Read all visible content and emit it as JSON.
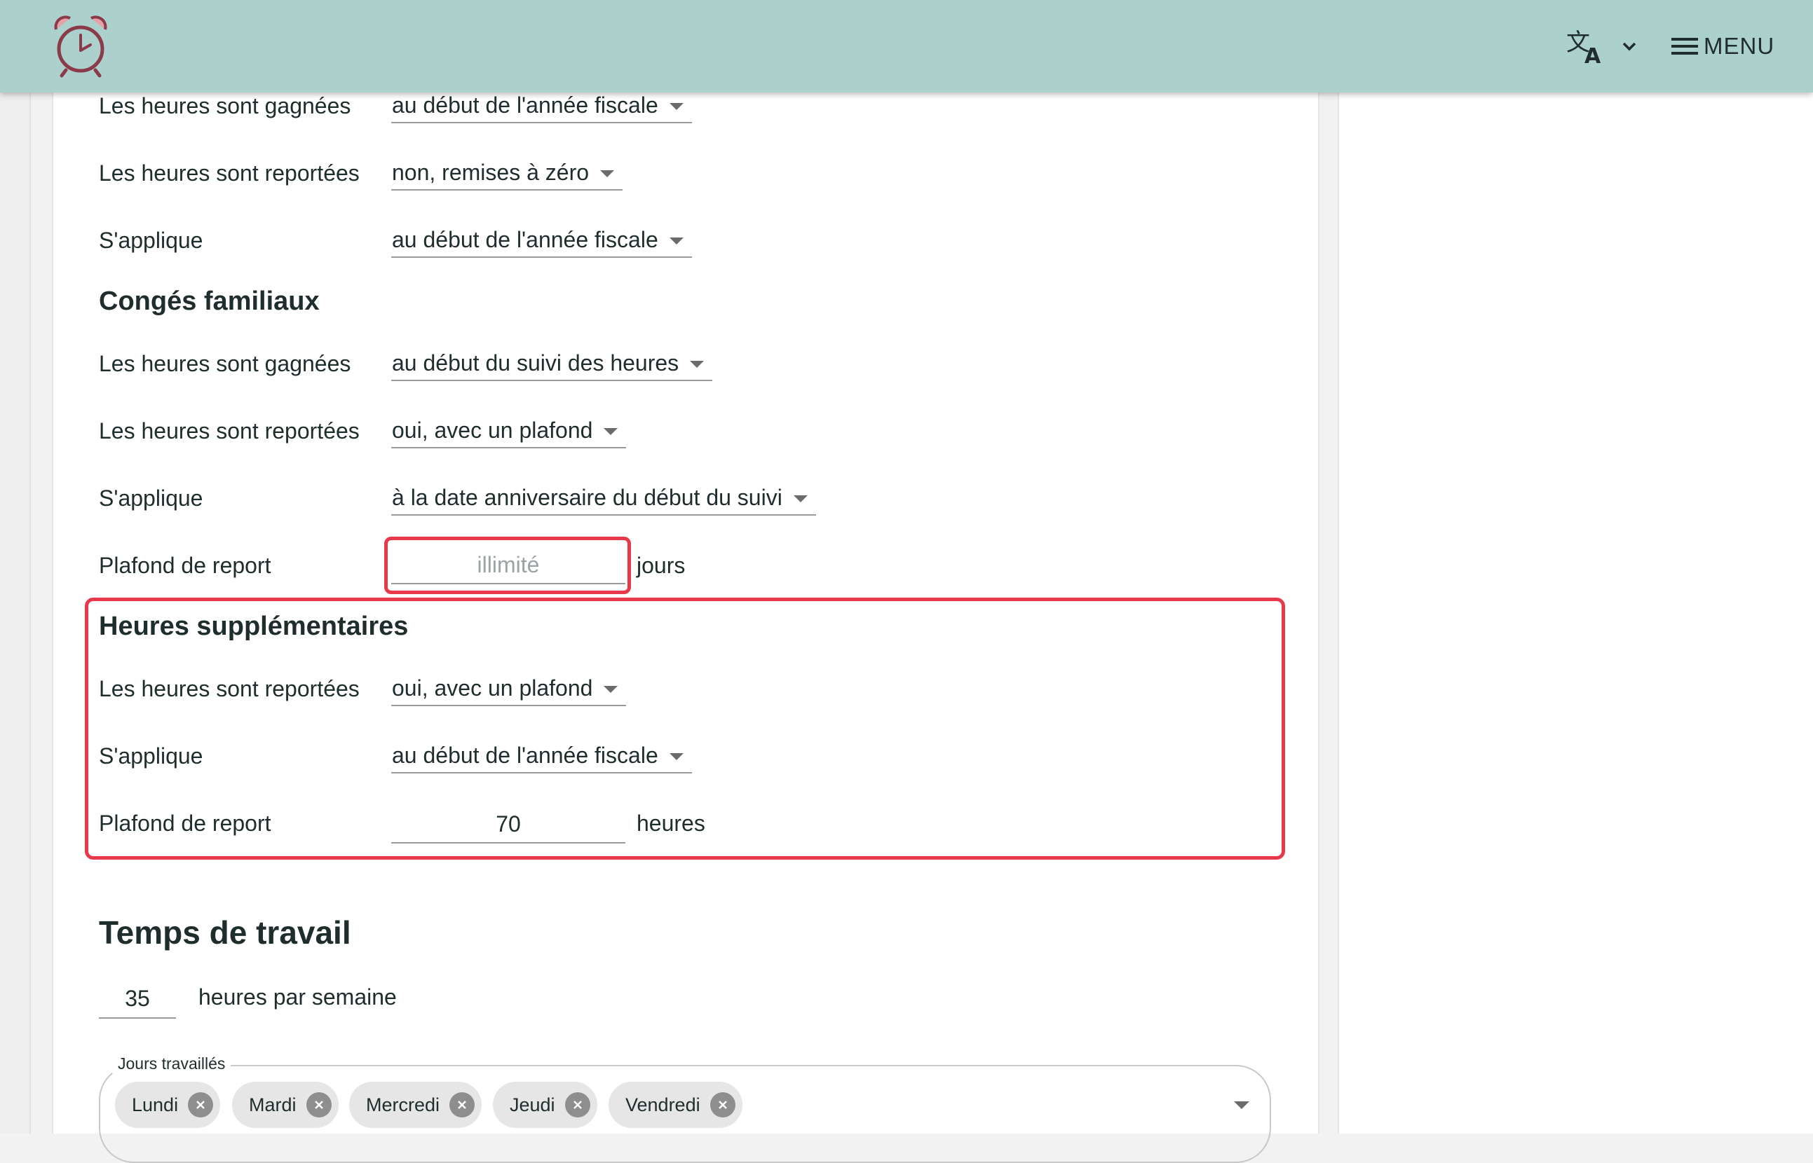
{
  "header": {
    "menu_label": "MENU",
    "logo_icon": "alarm-clock-icon",
    "language_icon": "translate-icon",
    "brand_color": "#acd1cd",
    "highlight_color": "#e8394a"
  },
  "section_top": {
    "rows": [
      {
        "label": "Les heures sont gagnées",
        "value": "au début de l'année fiscale"
      },
      {
        "label": "Les heures sont reportées",
        "value": "non, remises à zéro"
      },
      {
        "label": "S'applique",
        "value": "au début de l'année fiscale"
      }
    ]
  },
  "family_leave": {
    "title": "Congés familiaux",
    "rows": [
      {
        "label": "Les heures sont gagnées",
        "value": "au début du suivi des heures"
      },
      {
        "label": "Les heures sont reportées",
        "value": "oui, avec un plafond"
      },
      {
        "label": "S'applique",
        "value": "à la date anniversaire du début du suivi"
      }
    ],
    "cap_label": "Plafond de report",
    "cap_placeholder": "illimité",
    "cap_value": "",
    "cap_unit": "jours"
  },
  "overtime": {
    "title": "Heures supplémentaires",
    "rows": [
      {
        "label": "Les heures sont reportées",
        "value": "oui, avec un plafond"
      },
      {
        "label": "S'applique",
        "value": "au début de l'année fiscale"
      }
    ],
    "cap_label": "Plafond de report",
    "cap_value": "70",
    "cap_unit": "heures"
  },
  "work_time": {
    "title": "Temps de travail",
    "hours_value": "35",
    "hours_unit": "heures par semaine",
    "days_label": "Jours travaillés",
    "days": [
      "Lundi",
      "Mardi",
      "Mercredi",
      "Jeudi",
      "Vendredi"
    ]
  }
}
